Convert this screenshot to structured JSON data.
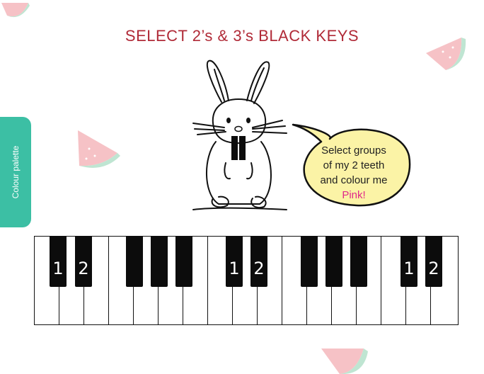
{
  "title": "SELECT 2’s & 3’s BLACK KEYS",
  "sidebar": {
    "palette_label": "Colour palette"
  },
  "speech_bubble": {
    "line1": "Select groups",
    "line2": "of my 2 teeth",
    "line3": "and colour me",
    "highlight": "Pink!"
  },
  "keyboard": {
    "labels": [
      "1",
      "2",
      "1",
      "2",
      "1",
      "2"
    ]
  },
  "colors": {
    "title": "#b02a37",
    "palette_tab": "#3cbfa4",
    "bubble_fill": "#fbf3a6",
    "highlight": "#e0288a"
  }
}
